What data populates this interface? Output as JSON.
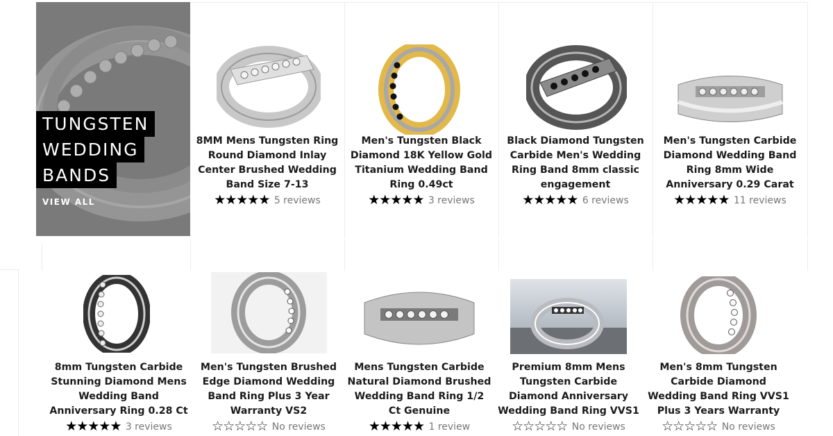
{
  "collection": {
    "title_lines": [
      "TUNGSTEN",
      "WEDDING",
      "BANDS"
    ],
    "view_all_label": "VIEW ALL"
  },
  "colors": {
    "star": "#000000",
    "review_text": "#777777",
    "tile_overlay": "#7d7d7d"
  },
  "products": [
    {
      "title": "8MM Mens Tungsten Ring Round Diamond Inlay Center Brushed Wedding Band Size 7-13",
      "rating": 5,
      "reviews_label": "5 reviews",
      "image_icon": "silver-channel-set-ring"
    },
    {
      "title": "Men's Tungsten Black Diamond 18K Yellow Gold Titanium Wedding Band Ring 0.49ct",
      "rating": 5,
      "reviews_label": "3 reviews",
      "image_icon": "gold-black-diamond-ring"
    },
    {
      "title": "Black Diamond Tungsten Carbide Men's Wedding Ring Band 8mm classic engagement",
      "rating": 5,
      "reviews_label": "6 reviews",
      "image_icon": "gunmetal-black-diamond-ring"
    },
    {
      "title": "Men's Tungsten Carbide Diamond Wedding Band Ring 8mm Wide Anniversary 0.29 Carat",
      "rating": 5,
      "reviews_label": "11 reviews",
      "image_icon": "silver-diamond-band"
    },
    {
      "title": "8mm Tungsten Carbide Stunning Diamond Mens Wedding Band Anniversary Ring 0.28 Ct",
      "rating": 5,
      "reviews_label": "3 reviews",
      "image_icon": "eternity-diamond-ring"
    },
    {
      "title": "Men's Tungsten Brushed Edge Diamond Wedding Band Ring Plus 3 Year Warranty VS2",
      "rating": 0,
      "reviews_label": "No reviews",
      "image_icon": "brushed-diamond-ring"
    },
    {
      "title": "Mens Tungsten Carbide Natural Diamond Brushed Wedding Band Ring 1/2 Ct Genuine",
      "rating": 5,
      "reviews_label": "1 review",
      "image_icon": "natural-diamond-band"
    },
    {
      "title": "Premium 8mm Mens Tungsten Carbide Diamond Anniversary Wedding Band Ring VVS1",
      "rating": 0,
      "reviews_label": "No reviews",
      "image_icon": "ring-in-box-photo"
    },
    {
      "title": "Men's 8mm Tungsten Carbide Diamond Wedding Band Ring VVS1 Plus 3 Years Warranty",
      "rating": 0,
      "reviews_label": "No reviews",
      "image_icon": "satin-diamond-ring"
    }
  ]
}
